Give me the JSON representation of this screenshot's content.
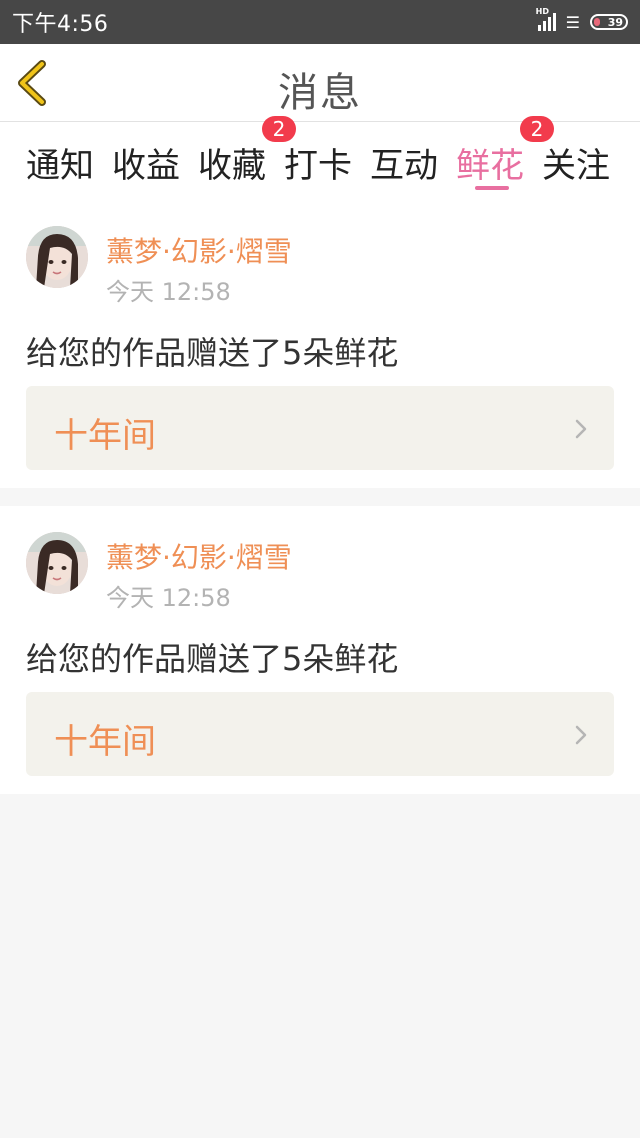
{
  "status_bar": {
    "time": "下午4:56",
    "network": "HD",
    "battery": "39"
  },
  "header": {
    "title": "消息"
  },
  "tabs": [
    {
      "label": "通知",
      "badge": null
    },
    {
      "label": "收益",
      "badge": null
    },
    {
      "label": "收藏",
      "badge": "2"
    },
    {
      "label": "打卡",
      "badge": null
    },
    {
      "label": "互动",
      "badge": null
    },
    {
      "label": "鲜花",
      "badge": null,
      "active": true
    },
    {
      "label": "关注",
      "badge": "2"
    }
  ],
  "messages": [
    {
      "username": "薰梦·幻影·熠雪",
      "time": "今天 12:58",
      "text": "给您的作品赠送了5朵鲜花",
      "work_title": "十年间"
    },
    {
      "username": "薰梦·幻影·熠雪",
      "time": "今天 12:58",
      "text": "给您的作品赠送了5朵鲜花",
      "work_title": "十年间"
    }
  ],
  "colors": {
    "accent_pink": "#e86fa0",
    "username_orange": "#ef8f55",
    "badge_red": "#f23b4c",
    "back_chevron_yellow": "#f0c419"
  }
}
